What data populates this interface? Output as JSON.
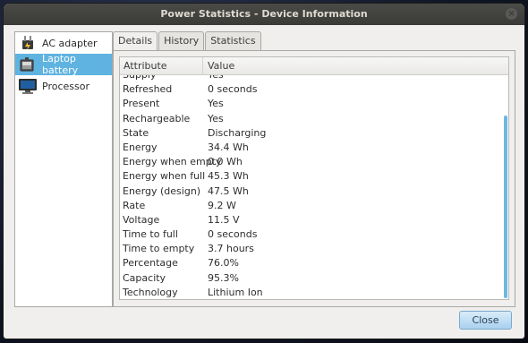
{
  "window": {
    "title": "Power Statistics - Device Information"
  },
  "sidebar": {
    "items": [
      {
        "label": "AC adapter",
        "icon": "ac-adapter-icon",
        "selected": false
      },
      {
        "label": "Laptop battery",
        "icon": "battery-icon",
        "selected": true
      },
      {
        "label": "Processor",
        "icon": "monitor-icon",
        "selected": false
      }
    ]
  },
  "tabs": [
    {
      "label": "Details",
      "active": true
    },
    {
      "label": "History",
      "active": false
    },
    {
      "label": "Statistics",
      "active": false
    }
  ],
  "table": {
    "headers": [
      "Attribute",
      "Value"
    ],
    "rows": [
      [
        "Supply",
        "Yes"
      ],
      [
        "Refreshed",
        "0 seconds"
      ],
      [
        "Present",
        "Yes"
      ],
      [
        "Rechargeable",
        "Yes"
      ],
      [
        "State",
        "Discharging"
      ],
      [
        "Energy",
        "34.4 Wh"
      ],
      [
        "Energy when empty",
        "0.0 Wh"
      ],
      [
        "Energy when full",
        "45.3 Wh"
      ],
      [
        "Energy (design)",
        "47.5 Wh"
      ],
      [
        "Rate",
        "9.2 W"
      ],
      [
        "Voltage",
        "11.5 V"
      ],
      [
        "Time to full",
        "0 seconds"
      ],
      [
        "Time to empty",
        "3.7 hours"
      ],
      [
        "Percentage",
        "76.0%"
      ],
      [
        "Capacity",
        "95.3%"
      ],
      [
        "Technology",
        "Lithium Ion"
      ]
    ]
  },
  "buttons": {
    "close_label": "Close"
  },
  "colors": {
    "selection": "#5fb3e0",
    "titlebar": "#3c3b37",
    "scrollbar": "#6db8e3"
  }
}
